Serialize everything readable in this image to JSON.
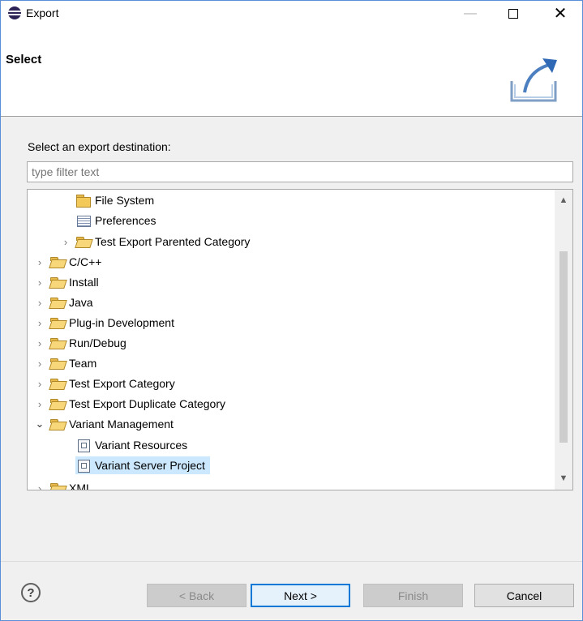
{
  "window": {
    "title": "Export",
    "controls": {
      "minimize": "—",
      "close": "✕"
    }
  },
  "banner": {
    "title": "Select",
    "icon": "export-wizard-icon"
  },
  "content": {
    "prompt": "Select an export destination:",
    "filter_placeholder": "type filter text"
  },
  "tree": {
    "items": [
      {
        "label": "File System",
        "icon": "folder-icon",
        "expanded": null
      },
      {
        "label": "Preferences",
        "icon": "preferences-icon",
        "expanded": null
      },
      {
        "label": "Test Export Parented Category",
        "icon": "folder-open-icon",
        "expanded": false
      },
      {
        "label": "C/C++",
        "icon": "folder-open-icon",
        "expanded": false
      },
      {
        "label": "Install",
        "icon": "folder-open-icon",
        "expanded": false
      },
      {
        "label": "Java",
        "icon": "folder-open-icon",
        "expanded": false
      },
      {
        "label": "Plug-in Development",
        "icon": "folder-open-icon",
        "expanded": false
      },
      {
        "label": "Run/Debug",
        "icon": "folder-open-icon",
        "expanded": false
      },
      {
        "label": "Team",
        "icon": "folder-open-icon",
        "expanded": false
      },
      {
        "label": "Test Export Category",
        "icon": "folder-open-icon",
        "expanded": false
      },
      {
        "label": "Test Export Duplicate Category",
        "icon": "folder-open-icon",
        "expanded": false
      },
      {
        "label": "Variant Management",
        "icon": "folder-open-icon",
        "expanded": true
      },
      {
        "label": "Variant Resources",
        "icon": "variant-icon",
        "expanded": null
      },
      {
        "label": "Variant Server Project",
        "icon": "variant-icon",
        "expanded": null,
        "selected": true
      },
      {
        "label": "XML",
        "icon": "folder-open-icon",
        "expanded": false
      }
    ],
    "chevrons": {
      "collapsed": "›",
      "expanded": "⌄"
    }
  },
  "buttons": {
    "help": "?",
    "back": "< Back",
    "next": "Next >",
    "finish": "Finish",
    "cancel": "Cancel"
  },
  "colors": {
    "selection": "#cce8ff",
    "default_button_border": "#0078d7"
  }
}
